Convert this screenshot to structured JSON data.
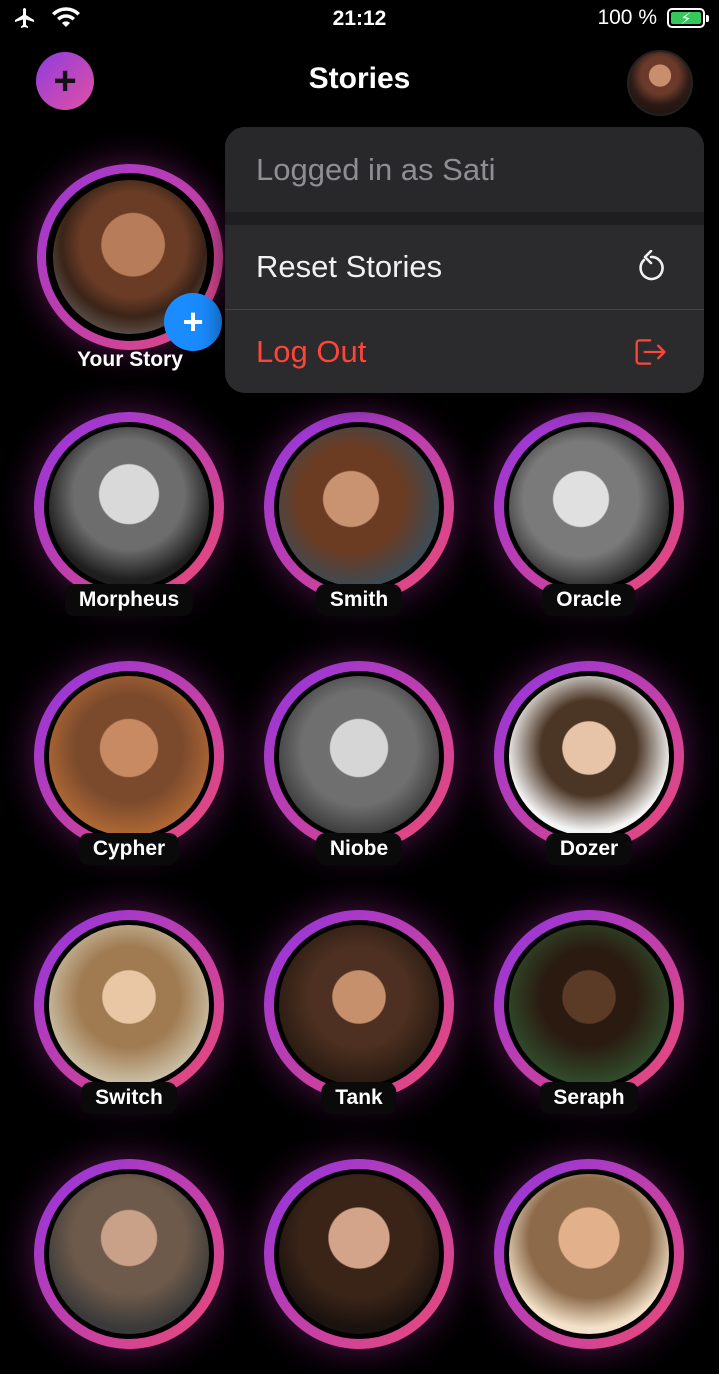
{
  "status_bar": {
    "time": "21:12",
    "battery_percent": "100 %",
    "battery_level": 1.0
  },
  "header": {
    "title": "Stories",
    "add_label": "+"
  },
  "your_story": {
    "label": "Your Story",
    "plus_label": "+"
  },
  "menu": {
    "header": "Logged in as Sati",
    "items": [
      {
        "label": "Reset Stories",
        "icon": "reset-icon"
      },
      {
        "label": "Log Out",
        "icon": "logout-icon",
        "color": "#ff453a"
      }
    ]
  },
  "stories": [
    {
      "name": "Morpheus"
    },
    {
      "name": "Smith"
    },
    {
      "name": "Oracle"
    },
    {
      "name": "Cypher"
    },
    {
      "name": "Niobe"
    },
    {
      "name": "Dozer"
    },
    {
      "name": "Switch"
    },
    {
      "name": "Tank"
    },
    {
      "name": "Seraph"
    },
    {
      "name": ""
    },
    {
      "name": ""
    },
    {
      "name": ""
    }
  ],
  "colors": {
    "ring_start": "#9a36d8",
    "ring_end": "#e4487f",
    "accent_blue": "#1a8cff",
    "danger": "#ff453a"
  }
}
